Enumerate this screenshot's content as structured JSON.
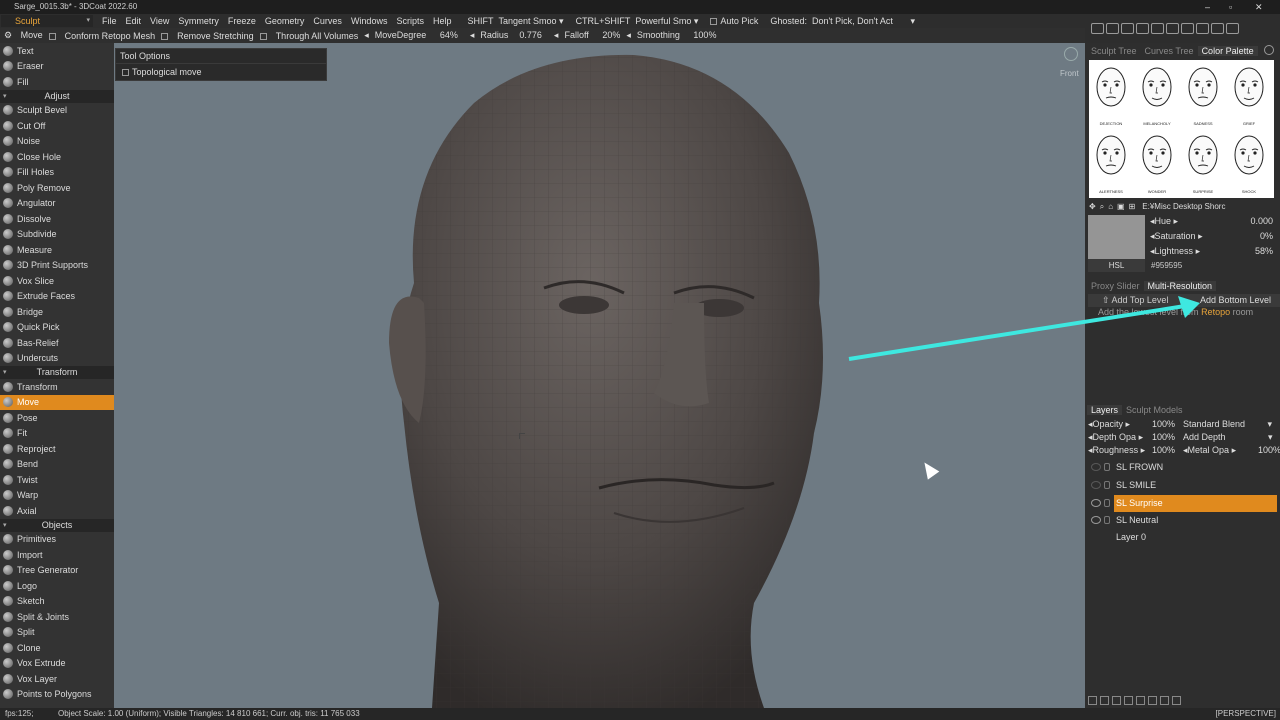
{
  "window": {
    "title": "Sarge_0015.3b* - 3DCoat 2022.60"
  },
  "menubar": {
    "room": "Sculpt",
    "items": [
      "File",
      "Edit",
      "View",
      "Symmetry",
      "Freeze",
      "Geometry",
      "Curves",
      "Windows",
      "Scripts",
      "Help"
    ],
    "shift_label": "SHIFT",
    "shift_value": "Tangent Smoo",
    "ctrlshift_label": "CTRL+SHIFT",
    "ctrlshift_value": "Powerful Smo",
    "auto_pick": "Auto Pick",
    "ghosted_label": "Ghosted:",
    "ghosted_value": "Don't Pick, Don't Act"
  },
  "toolbar": {
    "tool": "Move",
    "conform": "Conform Retopo Mesh",
    "remove_stretching": "Remove Stretching",
    "through_volumes": "Through All Volumes",
    "move_degree_label": "MoveDegree",
    "move_degree": "64%",
    "radius_label": "Radius",
    "radius": "0.776",
    "falloff_label": "Falloff",
    "falloff": "20%",
    "smoothing_label": "Smoothing",
    "smoothing": "100%"
  },
  "left_panel": {
    "top_items": [
      "Text",
      "Eraser",
      "Fill"
    ],
    "adjust_header": "Adjust",
    "adjust_items": [
      "Sculpt Bevel",
      "Cut Off",
      "Noise",
      "Close Hole",
      "Fill Holes",
      "Poly Remove",
      "Angulator",
      "Dissolve",
      "Subdivide",
      "Measure",
      "3D Print Supports",
      "Vox Slice",
      "Extrude Faces",
      "Bridge",
      "Quick Pick",
      "Bas-Relief",
      "Undercuts"
    ],
    "transform_header": "Transform",
    "transform_items": [
      "Transform",
      "Move",
      "Pose",
      "Fit",
      "Reproject",
      "Bend",
      "Twist",
      "Warp",
      "Axial"
    ],
    "objects_header": "Objects",
    "objects_items": [
      "Primitives",
      "Import",
      "Tree Generator",
      "Logo",
      "Sketch",
      "Split & Joints",
      "Split",
      "Clone",
      "Vox Extrude",
      "Vox Layer",
      "Points to Polygons"
    ]
  },
  "tool_options": {
    "title": "Tool Options",
    "topological_move": "Topological move"
  },
  "viewport": {
    "view_label": "Front"
  },
  "right_panel": {
    "top_tabs": [
      "Sculpt Tree",
      "Curves Tree",
      "Color Palette"
    ],
    "faces": [
      "DEJECTION",
      "MELANCHOLY",
      "SADNESS",
      "GRIEF",
      "ALERTNESS",
      "WONDER",
      "SURPRISE",
      "SHOCK"
    ],
    "palette_path": "E:¥Misc Desktop Shorc",
    "color": {
      "hue_label": "Hue",
      "hue": "0.000",
      "sat_label": "Saturation",
      "sat": "0%",
      "light_label": "Lightness",
      "light": "58%",
      "mode": "HSL",
      "hex": "#959595",
      "swatch": "#959595"
    },
    "mr_tabs": [
      "Proxy Slider",
      "Multi-Resolution"
    ],
    "add_top": "Add Top Level",
    "add_bottom": "Add Bottom Level",
    "add_lowest_prefix": "Add the lowest level from",
    "add_lowest_room": "Retopo",
    "add_lowest_suffix": "room",
    "layer_tabs": [
      "Layers",
      "Sculpt Models"
    ],
    "layer_props": {
      "opacity_label": "Opacity",
      "opacity": "100%",
      "blend": "Standard Blend",
      "depth_label": "Depth Opa",
      "depth": "100%",
      "add_depth": "Add Depth",
      "rough_label": "Roughness",
      "rough": "100%",
      "metal_label": "Metal Opa",
      "metal": "100%"
    },
    "layers": [
      "SL FROWN",
      "SL SMILE",
      "SL Surprise",
      "SL Neutral",
      "Layer 0"
    ]
  },
  "statusbar": {
    "fps": "fps:125;",
    "info": "Object Scale: 1.00 (Uniform);  Visible Triangles: 14 810 661;  Curr. obj. tris: 11 765 033",
    "view_mode": "[PERSPECTIVE]"
  },
  "colors": {
    "accent": "#e08a1e",
    "arrow": "#3ee8e0",
    "viewport_bg": "#6e7a83"
  }
}
